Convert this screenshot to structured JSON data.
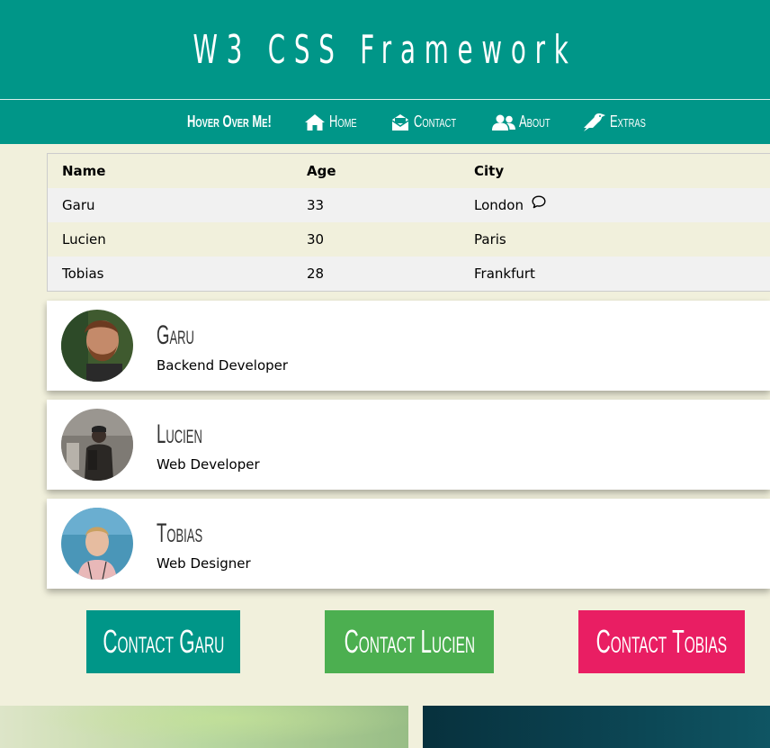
{
  "header": {
    "title": "W3 CSS Framework"
  },
  "nav": {
    "items": [
      {
        "label": "Hover Over Me!",
        "icon": "none"
      },
      {
        "label": "Home",
        "icon": "home-icon"
      },
      {
        "label": "Contact",
        "icon": "envelope-open-icon"
      },
      {
        "label": "About",
        "icon": "users-icon"
      },
      {
        "label": "Extras",
        "icon": "bird-icon"
      }
    ]
  },
  "table": {
    "headers": [
      "Name",
      "Age",
      "City"
    ],
    "rows": [
      [
        "Garu",
        "33",
        "London"
      ],
      [
        "Lucien",
        "30",
        "Paris"
      ],
      [
        "Tobias",
        "28",
        "Frankfurt"
      ]
    ]
  },
  "cards": [
    {
      "name": "Garu",
      "role": "Backend Developer"
    },
    {
      "name": "Lucien",
      "role": "Web Developer"
    },
    {
      "name": "Tobias",
      "role": "Web Designer"
    }
  ],
  "buttons": [
    {
      "label": "Contact Garu",
      "color": "#009688"
    },
    {
      "label": "Contact Lucien",
      "color": "#4caf50"
    },
    {
      "label": "Contact Tobias",
      "color": "#e91e63"
    }
  ],
  "colors": {
    "teal": "#009688",
    "background": "#f1f0dc"
  }
}
